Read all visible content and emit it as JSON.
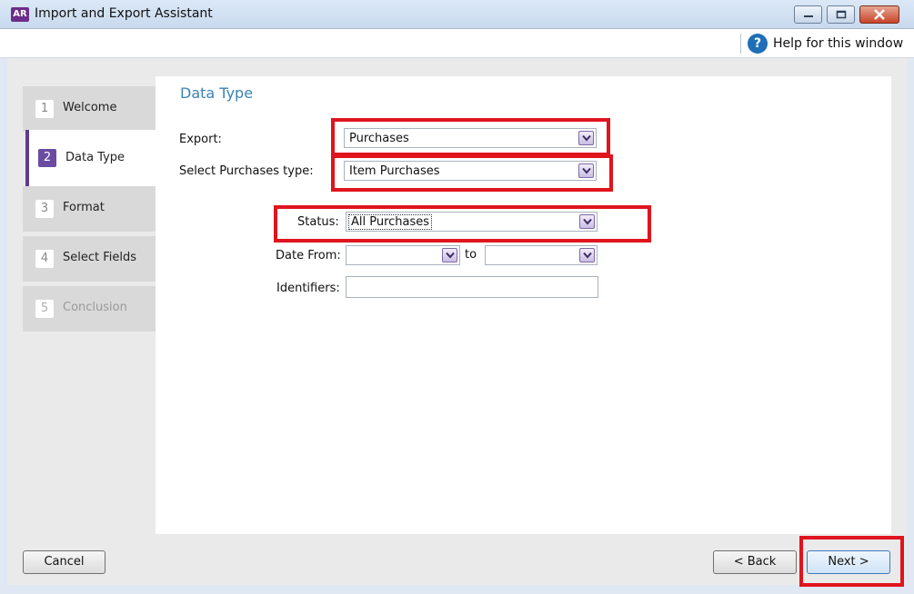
{
  "window": {
    "app_logo": "AR",
    "title": "Import and Export Assistant"
  },
  "help": {
    "label": "Help for this window"
  },
  "steps": [
    {
      "num": "1",
      "label": "Welcome",
      "state": "normal"
    },
    {
      "num": "2",
      "label": "Data Type",
      "state": "active"
    },
    {
      "num": "3",
      "label": "Format",
      "state": "normal"
    },
    {
      "num": "4",
      "label": "Select Fields",
      "state": "normal"
    },
    {
      "num": "5",
      "label": "Conclusion",
      "state": "disabled"
    }
  ],
  "main": {
    "section_title": "Data Type",
    "export": {
      "label": "Export:",
      "value": "Purchases"
    },
    "purchases_type": {
      "label": "Select Purchases type:",
      "value": "Item Purchases"
    },
    "status": {
      "label": "Status:",
      "value": "All Purchases"
    },
    "date_from": {
      "label": "Date From:",
      "value": ""
    },
    "date_to": {
      "label": "to",
      "value": ""
    },
    "identifiers": {
      "label": "Identifiers:",
      "value": ""
    }
  },
  "footer": {
    "cancel_label": "Cancel",
    "back_label": "< Back",
    "next_label": "Next >"
  },
  "colors": {
    "highlight": "#e0141d",
    "accent": "#6a4ba2",
    "section_title": "#3b82b8"
  }
}
